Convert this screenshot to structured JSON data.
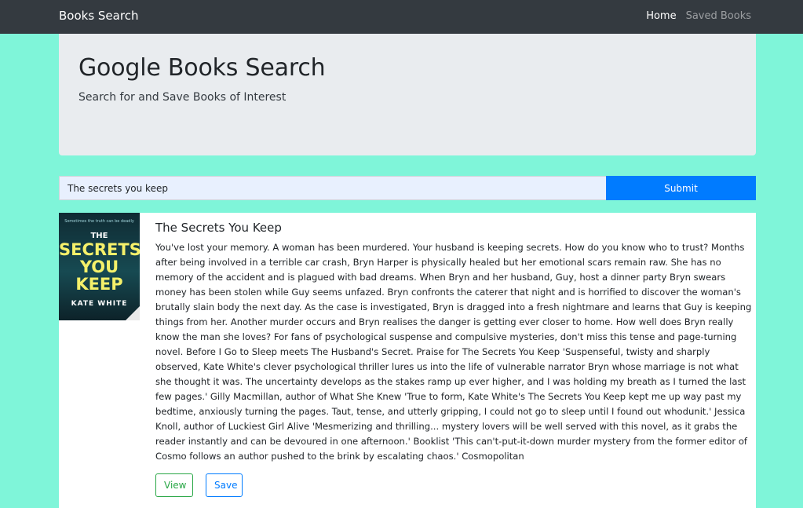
{
  "navbar": {
    "brand": "Books Search",
    "links": [
      {
        "label": "Home",
        "active": true
      },
      {
        "label": "Saved Books",
        "active": false
      }
    ]
  },
  "jumbotron": {
    "title": "Google Books Search",
    "subtitle": "Search for and Save Books of Interest"
  },
  "search": {
    "value": "The secrets you keep",
    "submit_label": "Submit"
  },
  "result": {
    "title": "The Secrets You Keep",
    "cover": {
      "tagline": "Sometimes the truth can be deadly",
      "line1": "THE",
      "line2": "SECRETS",
      "line3": "YOU",
      "line4": "KEEP",
      "author": "KATE WHITE"
    },
    "description": "You've lost your memory. A woman has been murdered. Your husband is keeping secrets. How do you know who to trust? Months after being involved in a terrible car crash, Bryn Harper is physically healed but her emotional scars remain raw. She has no memory of the accident and is plagued with bad dreams. When Bryn and her husband, Guy, host a dinner party Bryn swears money has been stolen while Guy seems unfazed. Bryn confronts the caterer that night and is horrified to discover the woman's brutally slain body the next day. As the case is investigated, Bryn is dragged into a fresh nightmare and learns that Guy is keeping things from her. Another murder occurs and Bryn realises the danger is getting ever closer to home. How well does Bryn really know the man she loves? For fans of psychological suspense and compulsive mysteries, don't miss this tense and page-turning novel. Before I Go to Sleep meets The Husband's Secret. Praise for The Secrets You Keep 'Suspenseful, twisty and sharply observed, Kate White's clever psychological thriller lures us into the life of vulnerable narrator Bryn whose marriage is not what she thought it was. The uncertainty develops as the stakes ramp up ever higher, and I was holding my breath as I turned the last few pages.' Gilly Macmillan, author of What She Knew 'True to form, Kate White's The Secrets You Keep kept me up way past my bedtime, anxiously turning the pages. Taut, tense, and utterly gripping, I could not go to sleep until I found out whodunit.' Jessica Knoll, author of Luckiest Girl Alive 'Mesmerizing and thrilling... mystery lovers will be well served with this novel, as it grabs the reader instantly and can be devoured in one afternoon.' Booklist 'This can't-put-it-down murder mystery from the former editor of Cosmo follows an author pushed to the brink by escalating chaos.' Cosmopolitan",
    "view_label": "View",
    "save_label": "Save"
  },
  "colors": {
    "page_bg": "#7ff5d9",
    "navbar_bg": "#343a40",
    "jumbotron_bg": "#e9ecef",
    "primary": "#007bff",
    "success": "#28a745"
  }
}
